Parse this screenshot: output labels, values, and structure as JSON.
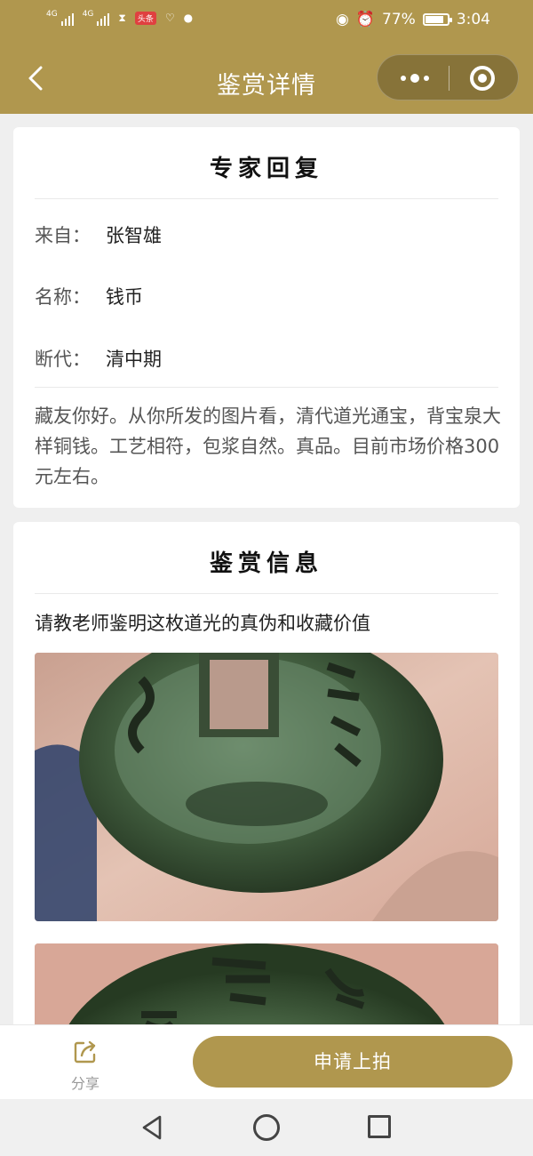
{
  "status_bar": {
    "sig1_label": "4G",
    "sig2_label": "4G",
    "news_badge": "头条",
    "battery_pct": "77%",
    "battery_level": 0.77,
    "time": "3:04"
  },
  "header": {
    "title": "鉴赏详情"
  },
  "expert_reply": {
    "title": "专家回复",
    "fields": [
      {
        "key": "来自：",
        "value": "张智雄"
      },
      {
        "key": "名称：",
        "value": "钱币"
      },
      {
        "key": "断代：",
        "value": "清中期"
      }
    ],
    "text": "藏友你好。从你所发的图片看，清代道光通宝，背宝泉大样铜钱。工艺相符，包浆自然。真品。目前市场价格300元左右。"
  },
  "appraisal_info": {
    "title": "鉴赏信息",
    "question": "请教老师鉴明这枚道光的真伪和收藏价值"
  },
  "bottom_bar": {
    "share_label": "分享",
    "apply_label": "申请上拍"
  },
  "colors": {
    "brand_gold": "#b0974e",
    "page_bg": "#efefef",
    "coin_green": "#3f5a3c"
  }
}
